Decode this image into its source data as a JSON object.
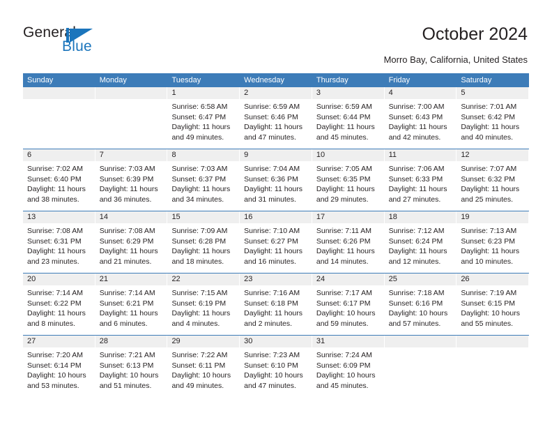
{
  "brand": {
    "name_top": "General",
    "name_bottom": "Blue",
    "mark": "triangle-flag-logo",
    "color": "#1b75bc"
  },
  "header": {
    "title": "October 2024",
    "subtitle": "Morro Bay, California, United States"
  },
  "theme": {
    "header_blue": "#3d7cb8",
    "daynum_band": "#efefef",
    "text": "#231f20"
  },
  "calendar": {
    "weekday_headers": [
      "Sunday",
      "Monday",
      "Tuesday",
      "Wednesday",
      "Thursday",
      "Friday",
      "Saturday"
    ],
    "weeks": [
      [
        {
          "day": "",
          "sunrise": "",
          "sunset": "",
          "daylight_1": "",
          "daylight_2": ""
        },
        {
          "day": "",
          "sunrise": "",
          "sunset": "",
          "daylight_1": "",
          "daylight_2": ""
        },
        {
          "day": "1",
          "sunrise": "Sunrise: 6:58 AM",
          "sunset": "Sunset: 6:47 PM",
          "daylight_1": "Daylight: 11 hours",
          "daylight_2": "and 49 minutes."
        },
        {
          "day": "2",
          "sunrise": "Sunrise: 6:59 AM",
          "sunset": "Sunset: 6:46 PM",
          "daylight_1": "Daylight: 11 hours",
          "daylight_2": "and 47 minutes."
        },
        {
          "day": "3",
          "sunrise": "Sunrise: 6:59 AM",
          "sunset": "Sunset: 6:44 PM",
          "daylight_1": "Daylight: 11 hours",
          "daylight_2": "and 45 minutes."
        },
        {
          "day": "4",
          "sunrise": "Sunrise: 7:00 AM",
          "sunset": "Sunset: 6:43 PM",
          "daylight_1": "Daylight: 11 hours",
          "daylight_2": "and 42 minutes."
        },
        {
          "day": "5",
          "sunrise": "Sunrise: 7:01 AM",
          "sunset": "Sunset: 6:42 PM",
          "daylight_1": "Daylight: 11 hours",
          "daylight_2": "and 40 minutes."
        }
      ],
      [
        {
          "day": "6",
          "sunrise": "Sunrise: 7:02 AM",
          "sunset": "Sunset: 6:40 PM",
          "daylight_1": "Daylight: 11 hours",
          "daylight_2": "and 38 minutes."
        },
        {
          "day": "7",
          "sunrise": "Sunrise: 7:03 AM",
          "sunset": "Sunset: 6:39 PM",
          "daylight_1": "Daylight: 11 hours",
          "daylight_2": "and 36 minutes."
        },
        {
          "day": "8",
          "sunrise": "Sunrise: 7:03 AM",
          "sunset": "Sunset: 6:37 PM",
          "daylight_1": "Daylight: 11 hours",
          "daylight_2": "and 34 minutes."
        },
        {
          "day": "9",
          "sunrise": "Sunrise: 7:04 AM",
          "sunset": "Sunset: 6:36 PM",
          "daylight_1": "Daylight: 11 hours",
          "daylight_2": "and 31 minutes."
        },
        {
          "day": "10",
          "sunrise": "Sunrise: 7:05 AM",
          "sunset": "Sunset: 6:35 PM",
          "daylight_1": "Daylight: 11 hours",
          "daylight_2": "and 29 minutes."
        },
        {
          "day": "11",
          "sunrise": "Sunrise: 7:06 AM",
          "sunset": "Sunset: 6:33 PM",
          "daylight_1": "Daylight: 11 hours",
          "daylight_2": "and 27 minutes."
        },
        {
          "day": "12",
          "sunrise": "Sunrise: 7:07 AM",
          "sunset": "Sunset: 6:32 PM",
          "daylight_1": "Daylight: 11 hours",
          "daylight_2": "and 25 minutes."
        }
      ],
      [
        {
          "day": "13",
          "sunrise": "Sunrise: 7:08 AM",
          "sunset": "Sunset: 6:31 PM",
          "daylight_1": "Daylight: 11 hours",
          "daylight_2": "and 23 minutes."
        },
        {
          "day": "14",
          "sunrise": "Sunrise: 7:08 AM",
          "sunset": "Sunset: 6:29 PM",
          "daylight_1": "Daylight: 11 hours",
          "daylight_2": "and 21 minutes."
        },
        {
          "day": "15",
          "sunrise": "Sunrise: 7:09 AM",
          "sunset": "Sunset: 6:28 PM",
          "daylight_1": "Daylight: 11 hours",
          "daylight_2": "and 18 minutes."
        },
        {
          "day": "16",
          "sunrise": "Sunrise: 7:10 AM",
          "sunset": "Sunset: 6:27 PM",
          "daylight_1": "Daylight: 11 hours",
          "daylight_2": "and 16 minutes."
        },
        {
          "day": "17",
          "sunrise": "Sunrise: 7:11 AM",
          "sunset": "Sunset: 6:26 PM",
          "daylight_1": "Daylight: 11 hours",
          "daylight_2": "and 14 minutes."
        },
        {
          "day": "18",
          "sunrise": "Sunrise: 7:12 AM",
          "sunset": "Sunset: 6:24 PM",
          "daylight_1": "Daylight: 11 hours",
          "daylight_2": "and 12 minutes."
        },
        {
          "day": "19",
          "sunrise": "Sunrise: 7:13 AM",
          "sunset": "Sunset: 6:23 PM",
          "daylight_1": "Daylight: 11 hours",
          "daylight_2": "and 10 minutes."
        }
      ],
      [
        {
          "day": "20",
          "sunrise": "Sunrise: 7:14 AM",
          "sunset": "Sunset: 6:22 PM",
          "daylight_1": "Daylight: 11 hours",
          "daylight_2": "and 8 minutes."
        },
        {
          "day": "21",
          "sunrise": "Sunrise: 7:14 AM",
          "sunset": "Sunset: 6:21 PM",
          "daylight_1": "Daylight: 11 hours",
          "daylight_2": "and 6 minutes."
        },
        {
          "day": "22",
          "sunrise": "Sunrise: 7:15 AM",
          "sunset": "Sunset: 6:19 PM",
          "daylight_1": "Daylight: 11 hours",
          "daylight_2": "and 4 minutes."
        },
        {
          "day": "23",
          "sunrise": "Sunrise: 7:16 AM",
          "sunset": "Sunset: 6:18 PM",
          "daylight_1": "Daylight: 11 hours",
          "daylight_2": "and 2 minutes."
        },
        {
          "day": "24",
          "sunrise": "Sunrise: 7:17 AM",
          "sunset": "Sunset: 6:17 PM",
          "daylight_1": "Daylight: 10 hours",
          "daylight_2": "and 59 minutes."
        },
        {
          "day": "25",
          "sunrise": "Sunrise: 7:18 AM",
          "sunset": "Sunset: 6:16 PM",
          "daylight_1": "Daylight: 10 hours",
          "daylight_2": "and 57 minutes."
        },
        {
          "day": "26",
          "sunrise": "Sunrise: 7:19 AM",
          "sunset": "Sunset: 6:15 PM",
          "daylight_1": "Daylight: 10 hours",
          "daylight_2": "and 55 minutes."
        }
      ],
      [
        {
          "day": "27",
          "sunrise": "Sunrise: 7:20 AM",
          "sunset": "Sunset: 6:14 PM",
          "daylight_1": "Daylight: 10 hours",
          "daylight_2": "and 53 minutes."
        },
        {
          "day": "28",
          "sunrise": "Sunrise: 7:21 AM",
          "sunset": "Sunset: 6:13 PM",
          "daylight_1": "Daylight: 10 hours",
          "daylight_2": "and 51 minutes."
        },
        {
          "day": "29",
          "sunrise": "Sunrise: 7:22 AM",
          "sunset": "Sunset: 6:11 PM",
          "daylight_1": "Daylight: 10 hours",
          "daylight_2": "and 49 minutes."
        },
        {
          "day": "30",
          "sunrise": "Sunrise: 7:23 AM",
          "sunset": "Sunset: 6:10 PM",
          "daylight_1": "Daylight: 10 hours",
          "daylight_2": "and 47 minutes."
        },
        {
          "day": "31",
          "sunrise": "Sunrise: 7:24 AM",
          "sunset": "Sunset: 6:09 PM",
          "daylight_1": "Daylight: 10 hours",
          "daylight_2": "and 45 minutes."
        },
        {
          "day": "",
          "sunrise": "",
          "sunset": "",
          "daylight_1": "",
          "daylight_2": ""
        },
        {
          "day": "",
          "sunrise": "",
          "sunset": "",
          "daylight_1": "",
          "daylight_2": ""
        }
      ]
    ]
  }
}
